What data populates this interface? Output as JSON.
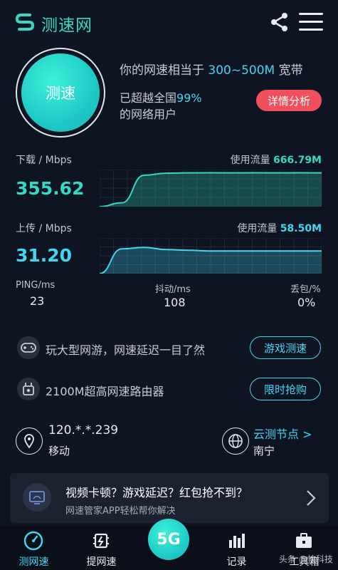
{
  "header": {
    "title": "测速网",
    "logo_icon": "logo-s-icon",
    "share_icon": "share-icon",
    "menu_icon": "menu-icon"
  },
  "hero": {
    "test_button": "测速",
    "speed_prefix": "你的网速相当于",
    "speed_range": "300~500M",
    "speed_suffix": "宽带",
    "beat_prefix": "已超越全国",
    "beat_percent": "99%",
    "beat_suffix": "的网络用户",
    "detail_button": "详情分析"
  },
  "download": {
    "label": "下载 / Mbps",
    "value": "355.62",
    "usage_label": "使用流量",
    "usage_value": "666.79M"
  },
  "upload": {
    "label": "上传 / Mbps",
    "value": "31.20",
    "usage_label": "使用流量",
    "usage_value": "58.50M"
  },
  "stats": {
    "ping_label": "PING/ms",
    "ping_value": "23",
    "jitter_label": "抖动/ms",
    "jitter_value": "108",
    "loss_label": "丢包/%",
    "loss_value": "0%"
  },
  "promos": [
    {
      "text": "玩大型网游，网速延迟一目了然",
      "button": "游戏测速",
      "icon": "gamepad-icon"
    },
    {
      "text": "2100M超高网速路由器",
      "button": "限时抢购",
      "icon": "router-icon"
    }
  ],
  "location": {
    "ip": "120.*.*.239",
    "isp": "移动",
    "node_label": "云测节点 >",
    "city": "南宁"
  },
  "banner": {
    "title": "视频卡顿？游戏延迟？红包抢不到？",
    "subtitle": "网速管家APP轻松帮你解决"
  },
  "tabs": [
    {
      "label": "测网速",
      "icon": "gauge-icon",
      "active": true
    },
    {
      "label": "提网速",
      "icon": "chip-icon",
      "active": false
    },
    {
      "label": "5G",
      "icon": "5g-icon",
      "active": false
    },
    {
      "label": "记录",
      "icon": "bar-chart-icon",
      "active": false
    },
    {
      "label": "工具箱",
      "icon": "toolbox-icon",
      "active": false
    }
  ],
  "watermark": "头条 @快科技",
  "colors": {
    "background": "#0f1423",
    "accent_teal": "#35d8c0",
    "accent_blue": "#41d7f0",
    "danger": "#f0505c"
  },
  "chart_data": [
    {
      "type": "area",
      "title": "下载",
      "x": [
        0,
        1,
        2,
        3,
        4,
        5,
        6,
        7,
        8,
        9,
        10
      ],
      "values": [
        0,
        40,
        330,
        352,
        355,
        356,
        355,
        356,
        355,
        356,
        355
      ]
    },
    {
      "type": "area",
      "title": "上传",
      "x": [
        0,
        1,
        2,
        3,
        4,
        5,
        6,
        7,
        8,
        9,
        10
      ],
      "values": [
        0,
        34,
        36,
        33,
        32,
        31,
        31,
        31,
        31,
        31,
        31
      ]
    }
  ]
}
